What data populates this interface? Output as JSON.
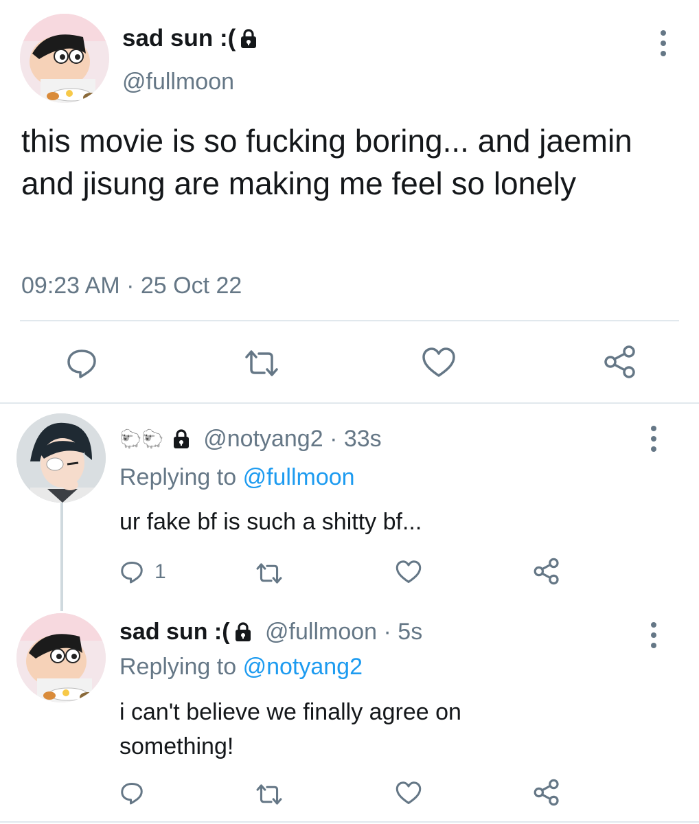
{
  "main_tweet": {
    "author_name": "sad sun :(",
    "handle": "@fullmoon",
    "text": "this movie is so fucking boring... and jaemin and jisung are making me feel so lonely",
    "time": "09:23 AM",
    "separator": "·",
    "date": "25 Oct 22",
    "avatar": "crayon-shinchan-avatar",
    "actions": [
      "reply-icon",
      "retweet-icon",
      "like-icon",
      "share-icon"
    ]
  },
  "replies": [
    {
      "author_name": "🐑🐑",
      "handle": "@notyang2",
      "separator": "·",
      "age": "33s",
      "replying_label": "Replying to",
      "replying_to": "@fullmoon",
      "text": "ur fake bf is such a shitty bf...",
      "reply_count": "1",
      "avatar": "anime-boy-avatar"
    },
    {
      "author_name": "sad sun :(",
      "handle": "@fullmoon",
      "separator": "·",
      "age": "5s",
      "replying_label": "Replying to",
      "replying_to": "@notyang2",
      "text": "i can't believe we finally agree on something!",
      "reply_count": "",
      "avatar": "crayon-shinchan-avatar"
    }
  ],
  "colors": {
    "text": "#14171a",
    "secondary": "#657786",
    "link": "#1d9bf0",
    "divider": "#e1e8ed",
    "thread_line": "#cfd9de"
  }
}
